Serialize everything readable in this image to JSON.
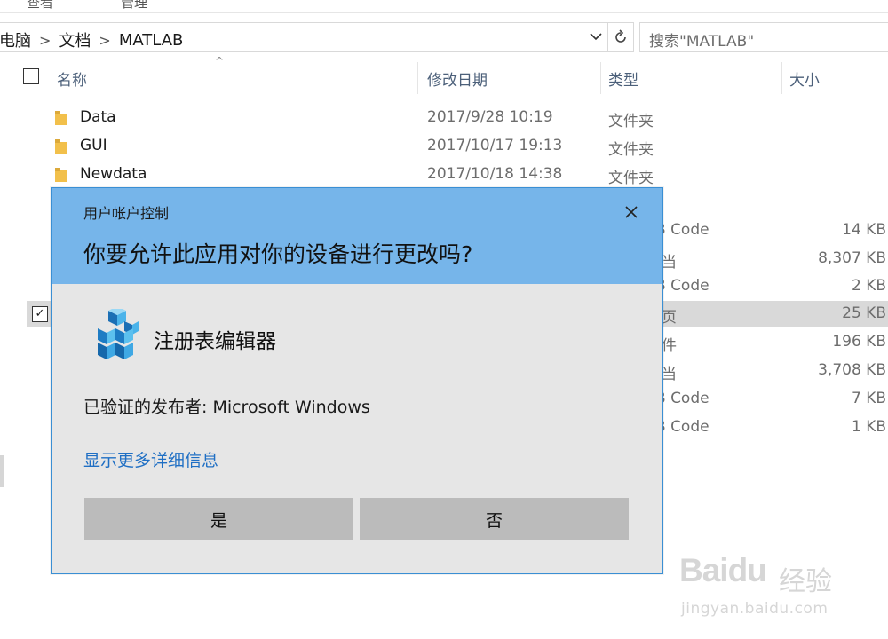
{
  "ribbon": {
    "left_label": "查看",
    "right_label": "管理"
  },
  "address": {
    "crumbs": [
      "电脑",
      "文档",
      "MATLAB"
    ],
    "search_placeholder": "搜索\"MATLAB\""
  },
  "columns": {
    "name": "名称",
    "date": "修改日期",
    "type": "类型",
    "size": "大小"
  },
  "files": [
    {
      "name": "Data",
      "date": "2017/9/28 10:19",
      "type": "文件夹",
      "size": ""
    },
    {
      "name": "GUI",
      "date": "2017/10/17 19:13",
      "type": "文件夹",
      "size": ""
    },
    {
      "name": "Newdata",
      "date": "2017/10/18 14:38",
      "type": "文件夹",
      "size": ""
    },
    {
      "name": "",
      "date": "",
      "type": "B Code",
      "size": "14 KB"
    },
    {
      "name": "",
      "date": "",
      "type": "当",
      "size": "8,307 KB"
    },
    {
      "name": "",
      "date": "",
      "type": "B Code",
      "size": "2 KB"
    },
    {
      "name": "",
      "date": "",
      "type": "页",
      "size": "25 KB"
    },
    {
      "name": "",
      "date": "",
      "type": "件",
      "size": "196 KB"
    },
    {
      "name": "",
      "date": "",
      "type": "当",
      "size": "3,708 KB"
    },
    {
      "name": "",
      "date": "",
      "type": "B Code",
      "size": "7 KB"
    },
    {
      "name": "",
      "date": "",
      "type": "B Code",
      "size": "1 KB"
    }
  ],
  "uac": {
    "caption": "用户帐户控制",
    "question": "你要允许此应用对你的设备进行更改吗?",
    "app_name": "注册表编辑器",
    "publisher": "已验证的发布者: Microsoft Windows",
    "more_details": "显示更多详细信息",
    "yes_label": "是",
    "no_label": "否",
    "header_color": "#76b5ea",
    "link_color": "#1f6fc4"
  },
  "watermark": {
    "brand": "Baidu",
    "brand_cn": "经验",
    "url": "jingyan.baidu.com"
  },
  "icons": {
    "folder": "folder-icon",
    "close": "close-icon",
    "refresh": "refresh-icon",
    "dropdown": "chevron-down-icon",
    "regedit": "registry-editor-icon"
  }
}
